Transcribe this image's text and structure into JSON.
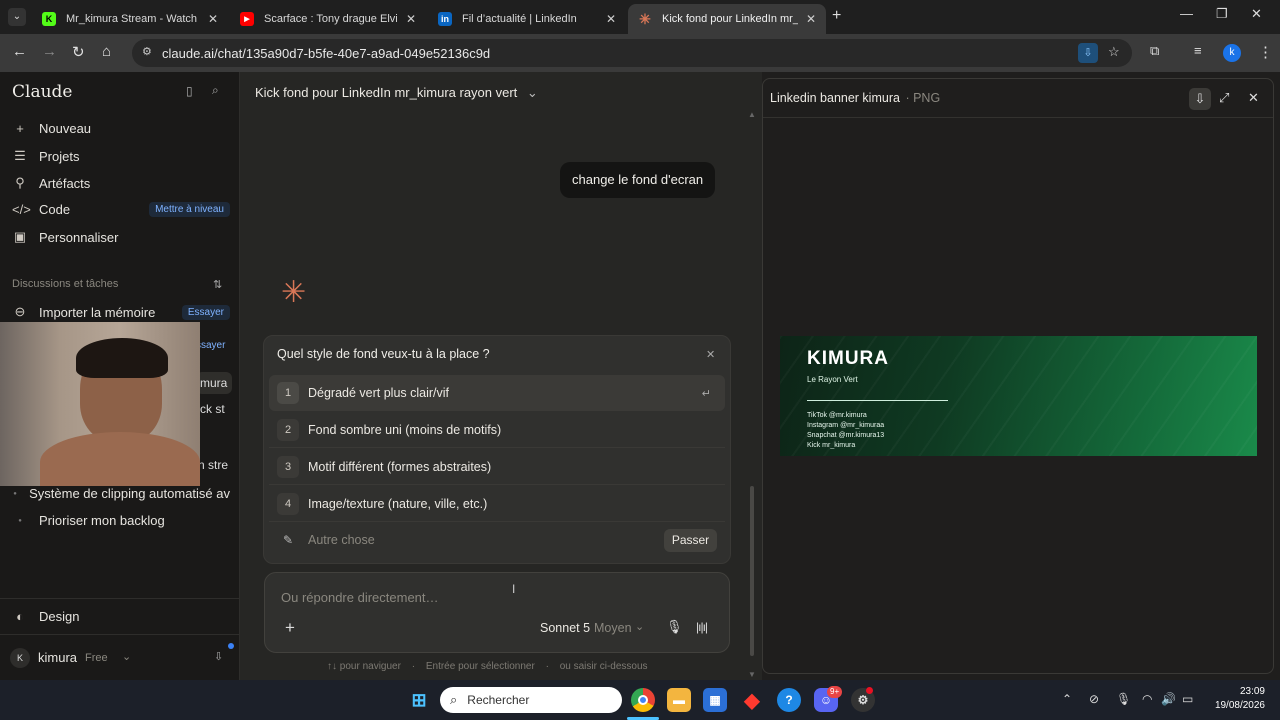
{
  "browser": {
    "tabs": [
      {
        "title": "Mr_kimura Stream - Watch Live",
        "favicon": "K",
        "color": "#53fc18"
      },
      {
        "title": "Scarface : Tony drague Elvira Cl",
        "favicon": "▶",
        "color": "#ff0000"
      },
      {
        "title": "Fil d’actualité | LinkedIn",
        "favicon": "in",
        "color": "#0a66c2"
      },
      {
        "title": "Kick fond pour LinkedIn mr_kim",
        "favicon": "✳",
        "color": "#d97757"
      }
    ],
    "url": "claude.ai/chat/135a90d7-b5fe-40e7-a9ad-049e52136c9d",
    "profile_initial": "k"
  },
  "sidebar": {
    "brand": "Claude",
    "nav": [
      {
        "label": "Nouveau",
        "icon": "plus-icon"
      },
      {
        "label": "Projets",
        "icon": "projects-icon"
      },
      {
        "label": "Artéfacts",
        "icon": "artifacts-icon"
      },
      {
        "label": "Code",
        "icon": "code-icon",
        "badge": "Mettre à niveau"
      },
      {
        "label": "Personnaliser",
        "icon": "briefcase-icon"
      }
    ],
    "section_label": "Discussions et tâches",
    "import": {
      "label": "Importer la mémoire",
      "badge": "Essayer"
    },
    "partial_badge": "ssayer",
    "partial_texts": [
      "mura",
      "ck st",
      "n stre"
    ],
    "recents": [
      "Système de clipping automatisé av",
      "Prioriser mon backlog"
    ],
    "design_label": "Design",
    "user": {
      "initial": "K",
      "name": "kimura",
      "plan": "Free"
    }
  },
  "chat": {
    "title": "Kick fond pour LinkedIn mr_kimura rayon vert",
    "user_message": "change le fond d'ecran",
    "question": {
      "title": "Quel style de fond veux-tu à la place ?",
      "options": [
        {
          "num": "1",
          "label": "Dégradé vert plus clair/vif"
        },
        {
          "num": "2",
          "label": "Fond sombre uni (moins de motifs)"
        },
        {
          "num": "3",
          "label": "Motif différent (formes abstraites)"
        },
        {
          "num": "4",
          "label": "Image/texture (nature, ville, etc.)"
        }
      ],
      "other_placeholder": "Autre chose",
      "skip_label": "Passer"
    },
    "composer": {
      "placeholder": "Ou répondre directement…",
      "model": "Sonnet 5",
      "effort": "Moyen"
    },
    "hints": [
      "↑↓ pour naviguer",
      "Entrée pour sélectionner",
      "ou saisir ci-dessous"
    ]
  },
  "artifact": {
    "title": "Linkedin banner kimura",
    "type": "PNG",
    "banner": {
      "name": "KIMURA",
      "subtitle": "Le Rayon Vert",
      "socials": [
        "TikTok  @mr.kimura",
        "Instagram  @mr_kimuraa",
        "Snapchat  @mr.kimura13",
        "Kick  mr_kimura"
      ]
    }
  },
  "taskbar": {
    "search_placeholder": "Rechercher",
    "time": "23:09",
    "date": "19/08/2026",
    "discord_badge": "9+"
  }
}
